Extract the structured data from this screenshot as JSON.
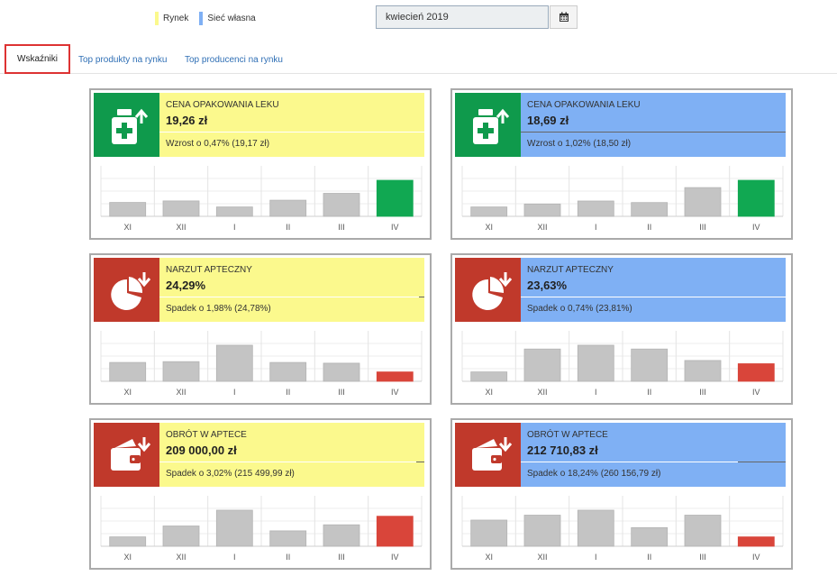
{
  "legend": {
    "market_label": "Rynek",
    "market_color": "#fbf98d",
    "own_label": "Sieć własna",
    "own_color": "#7fb0f4"
  },
  "date_picker": {
    "value": "kwiecień 2019",
    "icon": "calendar-icon"
  },
  "tabs": [
    {
      "label": "Wskaźniki",
      "active": true
    },
    {
      "label": "Top produkty na rynku",
      "active": false
    },
    {
      "label": "Top producenci na rynku",
      "active": false
    }
  ],
  "months": [
    "XI",
    "XII",
    "I",
    "II",
    "III",
    "IV"
  ],
  "colors": {
    "up": "#0f9a4c",
    "down": "#c0392b",
    "bar": "#c4c4c4",
    "bar_up": "#11a852",
    "bar_down": "#d9453a"
  },
  "cards": [
    {
      "scope": "market",
      "label": "CENA OPAKOWANIA LEKU",
      "value": "19,26 zł",
      "change": "Wzrost o 0,47% (19,17 zł)",
      "direction": "up",
      "icon": "medicine-bottle-icon",
      "progress": 1.0,
      "bars": [
        17.8,
        17.9,
        17.5,
        17.95,
        18.4,
        19.26
      ]
    },
    {
      "scope": "own",
      "label": "CENA OPAKOWANIA LEKU",
      "value": "18,69 zł",
      "change": "Wzrost o 1,02% (18,50 zł)",
      "direction": "up",
      "icon": "medicine-bottle-icon",
      "progress": 0.0,
      "bars": [
        16.9,
        17.1,
        17.3,
        17.2,
        18.2,
        18.69
      ]
    },
    {
      "scope": "market",
      "label": "NARZUT APTECZNY",
      "value": "24,29%",
      "change": "Spadek o 1,98% (24,78%)",
      "direction": "down",
      "icon": "pie-chart-icon",
      "progress": 0.98,
      "bars": [
        24.9,
        24.95,
        26.0,
        24.9,
        24.85,
        24.29
      ]
    },
    {
      "scope": "own",
      "label": "NARZUT APTECZNY",
      "value": "23,63%",
      "change": "Spadek o 0,74% (23,81%)",
      "direction": "down",
      "icon": "pie-chart-icon",
      "progress": 1.0,
      "bars": [
        23.2,
        24.4,
        24.6,
        24.4,
        23.8,
        23.63
      ]
    },
    {
      "scope": "market",
      "label": "OBRÓT W APTECE",
      "value": "209 000,00 zł",
      "change": "Spadek o 3,02% (215 499,99 zł)",
      "direction": "down",
      "icon": "wallet-icon",
      "progress": 0.97,
      "bars": [
        192000,
        201000,
        214000,
        197000,
        202000,
        209000
      ]
    },
    {
      "scope": "own",
      "label": "OBRÓT W APTECE",
      "value": "212 710,83 zł",
      "change": "Spadek o 18,24% (260 156,79 zł)",
      "direction": "down",
      "icon": "wallet-icon",
      "progress": 0.82,
      "bars": [
        233000,
        239000,
        245000,
        224000,
        239000,
        212710.83
      ]
    }
  ]
}
